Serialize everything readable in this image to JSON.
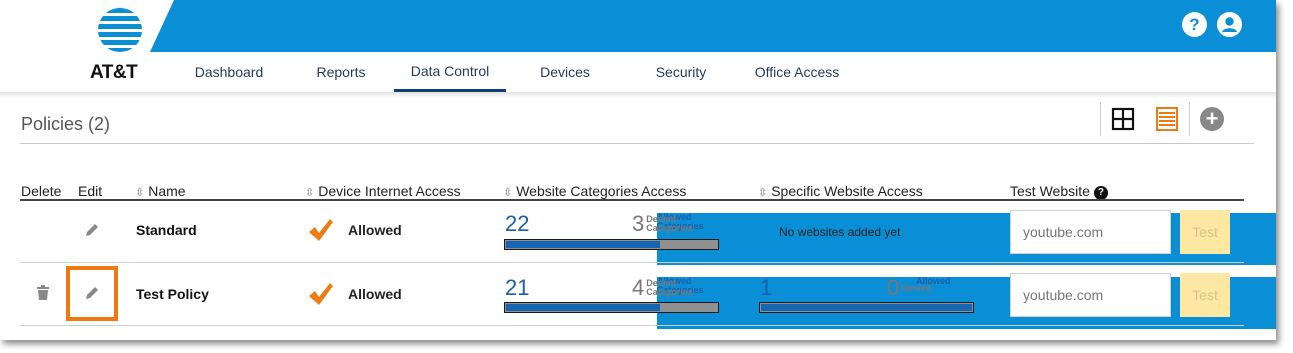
{
  "brand": {
    "name": "AT&T"
  },
  "header": {
    "help_glyph": "?",
    "colors": {
      "bar": "#0a8fd6",
      "accent": "#f07a12"
    }
  },
  "nav": {
    "items": [
      {
        "label": "Dashboard",
        "active": false
      },
      {
        "label": "Reports",
        "active": false
      },
      {
        "label": "Data Control",
        "active": true
      },
      {
        "label": "Devices",
        "active": false
      },
      {
        "label": "Security",
        "active": false
      },
      {
        "label": "Office Access",
        "active": false
      }
    ]
  },
  "policies": {
    "title": "Policies (2)",
    "tools": [
      "grid-view-icon",
      "list-view-icon",
      "add-icon"
    ],
    "add_glyph": "+"
  },
  "table": {
    "headers": {
      "delete": "Delete",
      "edit": "Edit",
      "name": "Name",
      "device_access": "Device Internet Access",
      "website_categories": "Website Categories Access",
      "specific_website": "Specific Website Access",
      "test_website": "Test Website"
    },
    "sort_glyph": "⇳",
    "help_glyph": "?",
    "rows": [
      {
        "name": "Standard",
        "device_access": "Allowed",
        "categories_allowed": "22",
        "categories_allowed_label": [
          "Allowed",
          "Categories"
        ],
        "categories_denied": "3",
        "categories_denied_label": [
          "Denied",
          "Categories"
        ],
        "categories_allowed_fraction": 0.73,
        "specific": "No websites added yet",
        "test_placeholder": "youtube.com",
        "test_label": "Test",
        "deletable": false
      },
      {
        "name": "Test Policy",
        "device_access": "Allowed",
        "categories_allowed": "21",
        "categories_allowed_label": [
          "Allowed",
          "Categories"
        ],
        "categories_denied": "4",
        "categories_denied_label": [
          "Denied",
          "Categories"
        ],
        "categories_allowed_fraction": 0.73,
        "specific_allowed": "1",
        "specific_allowed_label": "Allowed",
        "specific_denied": "0",
        "specific_denied_label": "Denied",
        "specific_allowed_fraction": 1.0,
        "test_placeholder": "youtube.com",
        "test_label": "Test",
        "deletable": true
      }
    ]
  }
}
